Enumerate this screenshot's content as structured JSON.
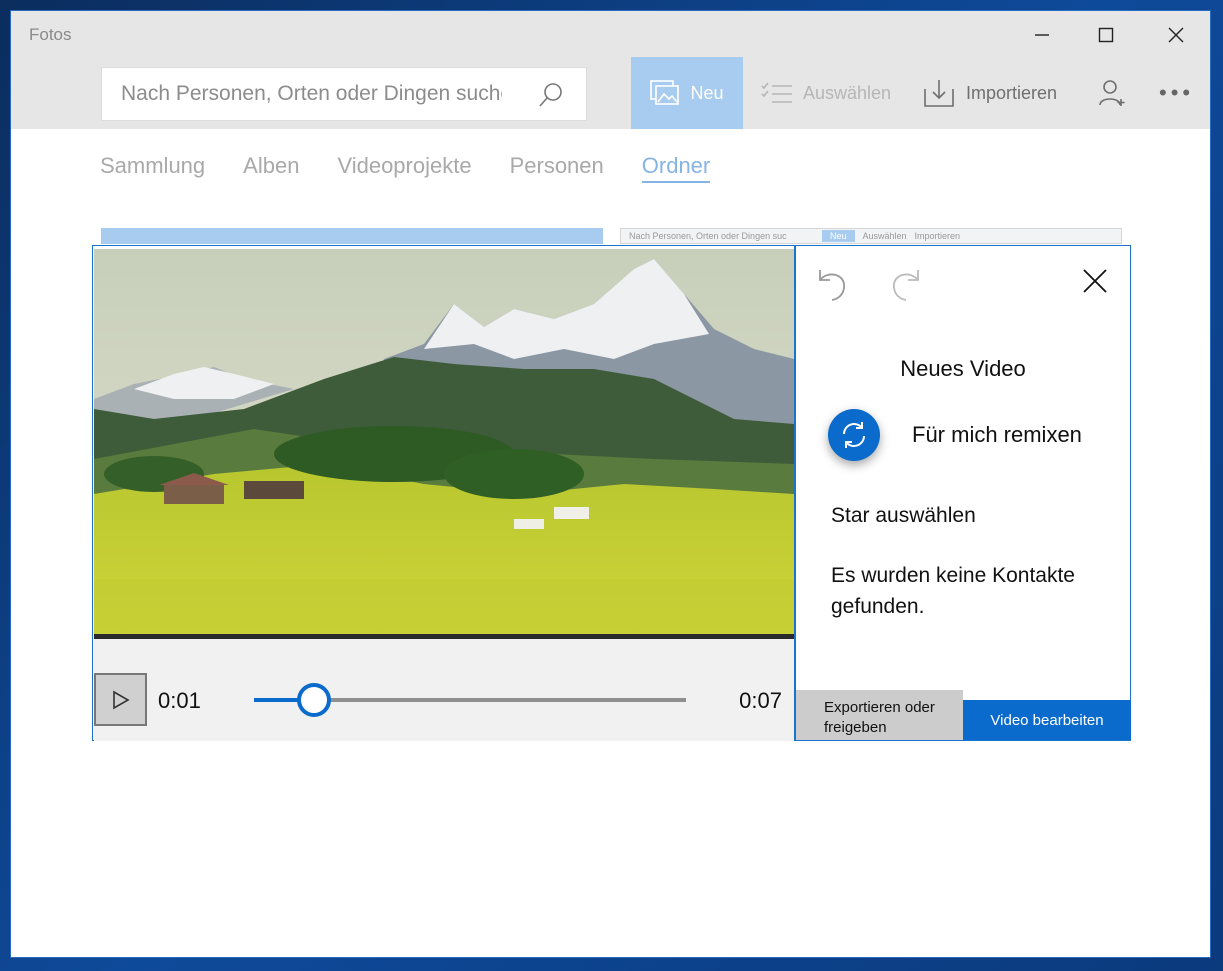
{
  "window": {
    "title": "Fotos"
  },
  "search": {
    "placeholder": "Nach Personen, Orten oder Dingen suchen"
  },
  "toolbar": {
    "new_label": "Neu",
    "select_label": "Auswählen",
    "import_label": "Importieren"
  },
  "tabs": [
    {
      "label": "Sammlung"
    },
    {
      "label": "Alben"
    },
    {
      "label": "Videoprojekte"
    },
    {
      "label": "Personen"
    },
    {
      "label": "Ordner",
      "active": true
    }
  ],
  "thumbnail_strip": {
    "search_text": "Nach Personen, Orten oder Dingen suc",
    "new_label": "Neu",
    "select_label": "Auswählen",
    "import_label": "Importieren"
  },
  "player": {
    "current_time": "0:01",
    "total_time": "0:07",
    "progress": 0.14
  },
  "panel": {
    "title": "Neues Video",
    "remix_label": "Für mich remixen",
    "star_label": "Star auswählen",
    "no_contacts": "Es wurden keine Kontakte gefunden.",
    "export_label": "Exportieren oder freigeben",
    "edit_label": "Video bearbeiten"
  },
  "colors": {
    "accent": "#0a6bcc",
    "accent_light": "#a8ccef",
    "titlebar": "#e6e6e6"
  },
  "icons": [
    "minimize-icon",
    "maximize-icon",
    "close-icon",
    "search-icon",
    "photo-new-icon",
    "checklist-icon",
    "import-icon",
    "add-person-icon",
    "more-icon",
    "undo-icon",
    "redo-icon",
    "close-panel-icon",
    "play-icon",
    "remix-icon"
  ]
}
